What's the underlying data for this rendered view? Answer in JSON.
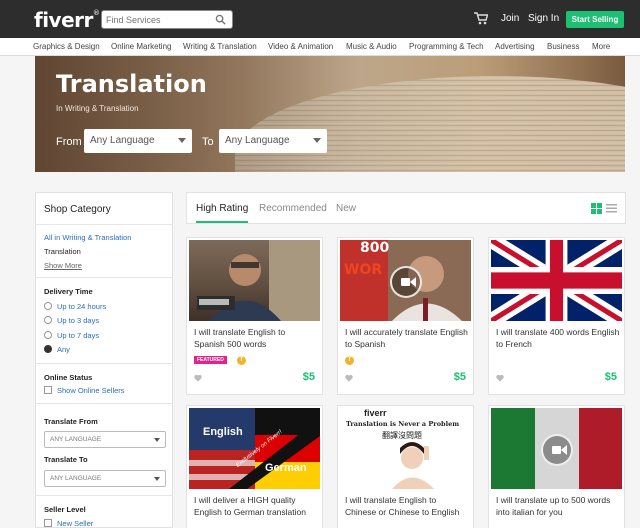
{
  "header": {
    "logo": "fiverr",
    "logo_mark": "®",
    "search_placeholder": "Find Services",
    "join": "Join",
    "sign_in": "Sign In",
    "start_selling": "Start Selling"
  },
  "categories": [
    "Graphics & Design",
    "Online Marketing",
    "Writing & Translation",
    "Video & Animation",
    "Music & Audio",
    "Programming & Tech",
    "Advertising",
    "Business",
    "More"
  ],
  "banner": {
    "title": "Translation",
    "subtitle": "In Writing & Translation",
    "from_label": "From",
    "from_value": "Any Language",
    "to_label": "To",
    "to_value": "Any Language"
  },
  "sidebar": {
    "shop_category": "Shop Category",
    "all_link": "All in Writing & Translation",
    "current": "Translation",
    "show_more": "Show More",
    "delivery_time": "Delivery Time",
    "delivery_options": [
      "Up to 24 hours",
      "Up to 3 days",
      "Up to 7 days",
      "Any"
    ],
    "delivery_selected": "Any",
    "online_status": "Online Status",
    "show_online": "Show Online Sellers",
    "translate_from": "Translate From",
    "translate_from_value": "ANY LANGUAGE",
    "translate_to": "Translate To",
    "translate_to_value": "ANY LANGUAGE",
    "seller_level": "Seller Level",
    "new_seller": "New Seller"
  },
  "tabs": [
    "High Rating",
    "Recommended",
    "New"
  ],
  "active_tab": "High Rating",
  "thumb_text": {
    "card2_top": "800",
    "card2_side": "WOR",
    "card4_line1": "English",
    "card4_line2": "German",
    "card4_ribbon": "Exclusively on Fiverr!",
    "card5_brand": "fiverr",
    "card5_headline": "Translation is Never a Problem",
    "card5_chinese": "翻譯沒問題"
  },
  "gigs": [
    {
      "title": "I will translate English to Spanish 500 words",
      "price": "$5",
      "featured": "FEATURED",
      "level": "T"
    },
    {
      "title": "I will accurately translate English to Spanish",
      "price": "$5",
      "level": "T"
    },
    {
      "title": "I will translate 400 words English to French",
      "price": "$5"
    },
    {
      "title": "I will deliver a HIGH quality English to German translation"
    },
    {
      "title": "I will translate English to Chinese or Chinese to English"
    },
    {
      "title": "I will translate up to 500 words into italian for you"
    }
  ],
  "colors": {
    "brand_green": "#1dbf73",
    "topbar": "#2d2d2d",
    "link_blue": "#2a6ebb",
    "featured_pink": "#e0248f",
    "level_gold": "#f0b429"
  }
}
